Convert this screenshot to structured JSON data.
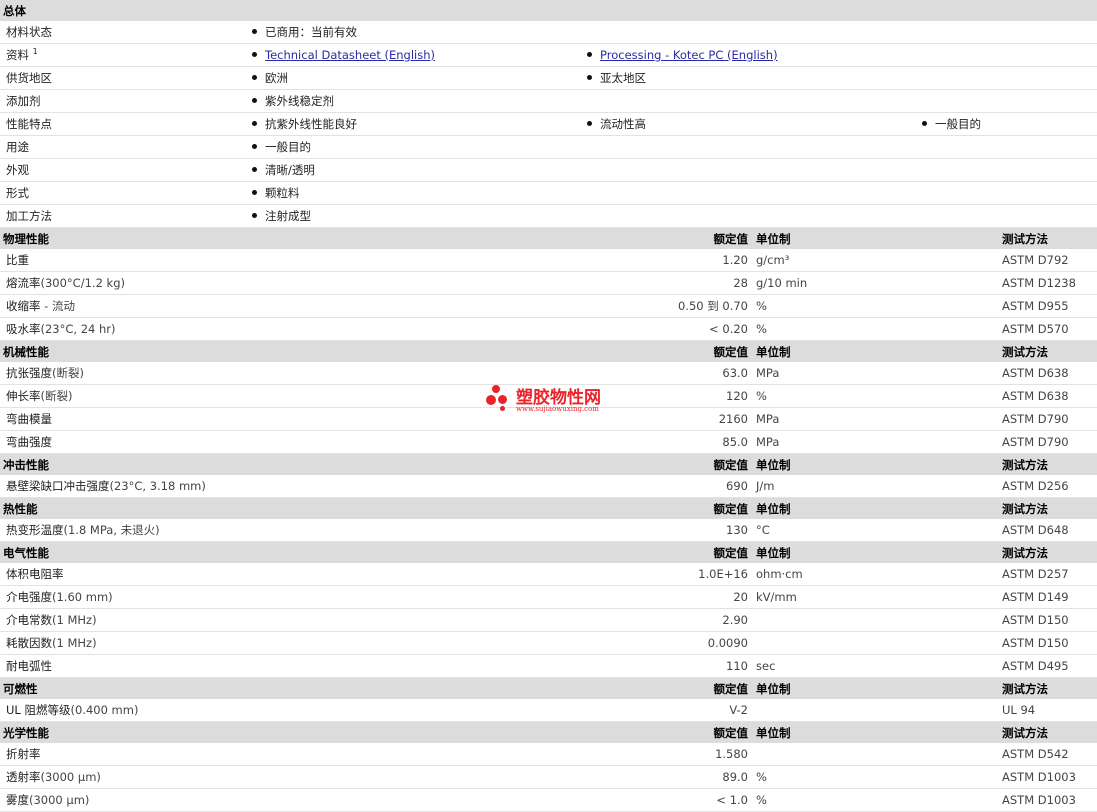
{
  "general": {
    "title": "总体",
    "rows": [
      {
        "label": "材料状态",
        "items": [
          "已商用：当前有效"
        ]
      },
      {
        "label": "资料",
        "sup": "1",
        "links": [
          "Technical Datasheet (English)",
          "Processing - Kotec PC (English)"
        ]
      },
      {
        "label": "供货地区",
        "items": [
          "欧洲",
          "亚太地区"
        ]
      },
      {
        "label": "添加剂",
        "items": [
          "紫外线稳定剂"
        ]
      },
      {
        "label": "性能特点",
        "items": [
          "抗紫外线性能良好",
          "流动性高",
          "一般目的"
        ]
      },
      {
        "label": "用途",
        "items": [
          "一般目的"
        ]
      },
      {
        "label": "外观",
        "items": [
          "清晰/透明"
        ]
      },
      {
        "label": "形式",
        "items": [
          "颗粒料"
        ]
      },
      {
        "label": "加工方法",
        "items": [
          "注射成型"
        ]
      }
    ]
  },
  "headers": {
    "value": "额定值",
    "unit": "单位制",
    "method": "测试方法"
  },
  "sections": [
    {
      "title": "物理性能",
      "rows": [
        {
          "name": "比重",
          "cond": "",
          "value": "1.20",
          "unit": "g/cm³",
          "method": "ASTM D792"
        },
        {
          "name": "熔流率",
          "cond": "(300°C/1.2 kg)",
          "value": "28",
          "unit": "g/10 min",
          "method": "ASTM D1238"
        },
        {
          "name": "收缩率",
          "cond": " - 流动",
          "value": "0.50 到  0.70",
          "unit": "%",
          "method": "ASTM D955"
        },
        {
          "name": "吸水率",
          "cond": "(23°C, 24 hr)",
          "value": "< 0.20",
          "unit": "%",
          "method": "ASTM D570"
        }
      ]
    },
    {
      "title": "机械性能",
      "rows": [
        {
          "name": "抗张强度",
          "cond": "(断裂)",
          "value": "63.0",
          "unit": "MPa",
          "method": "ASTM D638"
        },
        {
          "name": "伸长率",
          "cond": "(断裂)",
          "value": "120",
          "unit": "%",
          "method": "ASTM D638"
        },
        {
          "name": "弯曲模量",
          "cond": "",
          "value": "2160",
          "unit": "MPa",
          "method": "ASTM D790"
        },
        {
          "name": "弯曲强度",
          "cond": "",
          "value": "85.0",
          "unit": "MPa",
          "method": "ASTM D790"
        }
      ]
    },
    {
      "title": "冲击性能",
      "rows": [
        {
          "name": "悬壁梁缺口冲击强度",
          "cond": "(23°C, 3.18 mm)",
          "value": "690",
          "unit": "J/m",
          "method": "ASTM D256"
        }
      ]
    },
    {
      "title": "热性能",
      "rows": [
        {
          "name": "热变形温度",
          "cond": "(1.8 MPa, 未退火)",
          "value": "130",
          "unit": "°C",
          "method": "ASTM D648"
        }
      ]
    },
    {
      "title": "电气性能",
      "rows": [
        {
          "name": "体积电阻率",
          "cond": "",
          "value": "1.0E+16",
          "unit": "ohm·cm",
          "method": "ASTM D257"
        },
        {
          "name": "介电强度",
          "cond": "(1.60 mm)",
          "value": "20",
          "unit": "kV/mm",
          "method": "ASTM D149"
        },
        {
          "name": "介电常数",
          "cond": "(1 MHz)",
          "value": "2.90",
          "unit": "",
          "method": "ASTM D150"
        },
        {
          "name": "耗散因数",
          "cond": "(1 MHz)",
          "value": "0.0090",
          "unit": "",
          "method": "ASTM D150"
        },
        {
          "name": "耐电弧性",
          "cond": "",
          "value": "110",
          "unit": "sec",
          "method": "ASTM D495"
        }
      ]
    },
    {
      "title": "可燃性",
      "rows": [
        {
          "name": "UL 阻燃等级",
          "cond": "(0.400 mm)",
          "value": "V-2",
          "unit": "",
          "method": "UL 94"
        }
      ]
    },
    {
      "title": "光学性能",
      "rows": [
        {
          "name": "折射率",
          "cond": "",
          "value": "1.580",
          "unit": "",
          "method": "ASTM D542"
        },
        {
          "name": "透射率",
          "cond": "(3000 µm)",
          "value": "89.0",
          "unit": "%",
          "method": "ASTM D1003"
        },
        {
          "name": "雾度",
          "cond": "(3000 µm)",
          "value": "< 1.0",
          "unit": "%",
          "method": "ASTM D1003"
        }
      ]
    }
  ],
  "watermark": {
    "name": "塑胶物性网",
    "url": "www.sujiaowuxing.com",
    "color": "#e8242a"
  }
}
